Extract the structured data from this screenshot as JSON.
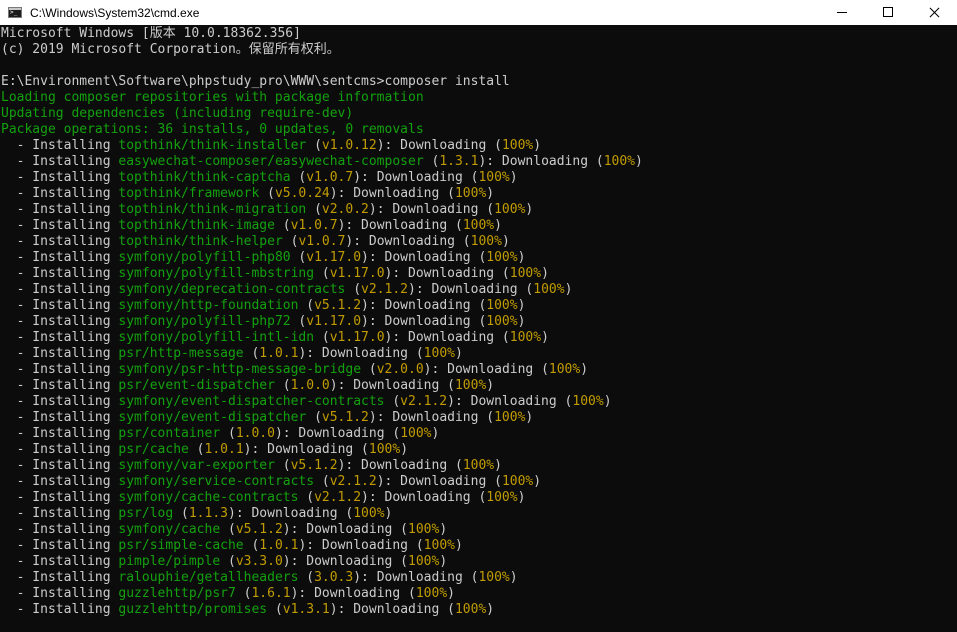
{
  "window": {
    "title": "C:\\Windows\\System32\\cmd.exe",
    "icon": "cmd-icon",
    "controls": {
      "minimize": "minimize-icon",
      "maximize": "maximize-icon",
      "close": "close-icon"
    }
  },
  "colors": {
    "background": "#0c0c0c",
    "text": "#cccccc",
    "info_green": "#13a10e",
    "highlight_yellow": "#c19c00"
  },
  "console": {
    "header": [
      "Microsoft Windows [版本 10.0.18362.356]",
      "(c) 2019 Microsoft Corporation。保留所有权利。"
    ],
    "prompt": "E:\\Environment\\Software\\phpstudy_pro\\WWW\\sentcms>",
    "command": "composer install",
    "info_lines": [
      "Loading composer repositories with package information",
      "Updating dependencies (including require-dev)",
      "Package operations: 36 installs, 0 updates, 0 removals"
    ],
    "install_prefix": "  - Installing ",
    "status_text": "Downloading",
    "progress": "100%",
    "packages": [
      {
        "name": "topthink/think-installer",
        "version": "v1.0.12"
      },
      {
        "name": "easywechat-composer/easywechat-composer",
        "version": "1.3.1"
      },
      {
        "name": "topthink/think-captcha",
        "version": "v1.0.7"
      },
      {
        "name": "topthink/framework",
        "version": "v5.0.24"
      },
      {
        "name": "topthink/think-migration",
        "version": "v2.0.2"
      },
      {
        "name": "topthink/think-image",
        "version": "v1.0.7"
      },
      {
        "name": "topthink/think-helper",
        "version": "v1.0.7"
      },
      {
        "name": "symfony/polyfill-php80",
        "version": "v1.17.0"
      },
      {
        "name": "symfony/polyfill-mbstring",
        "version": "v1.17.0"
      },
      {
        "name": "symfony/deprecation-contracts",
        "version": "v2.1.2"
      },
      {
        "name": "symfony/http-foundation",
        "version": "v5.1.2"
      },
      {
        "name": "symfony/polyfill-php72",
        "version": "v1.17.0"
      },
      {
        "name": "symfony/polyfill-intl-idn",
        "version": "v1.17.0"
      },
      {
        "name": "psr/http-message",
        "version": "1.0.1"
      },
      {
        "name": "symfony/psr-http-message-bridge",
        "version": "v2.0.0"
      },
      {
        "name": "psr/event-dispatcher",
        "version": "1.0.0"
      },
      {
        "name": "symfony/event-dispatcher-contracts",
        "version": "v2.1.2"
      },
      {
        "name": "symfony/event-dispatcher",
        "version": "v5.1.2"
      },
      {
        "name": "psr/container",
        "version": "1.0.0"
      },
      {
        "name": "psr/cache",
        "version": "1.0.1"
      },
      {
        "name": "symfony/var-exporter",
        "version": "v5.1.2"
      },
      {
        "name": "symfony/service-contracts",
        "version": "v2.1.2"
      },
      {
        "name": "symfony/cache-contracts",
        "version": "v2.1.2"
      },
      {
        "name": "psr/log",
        "version": "1.1.3"
      },
      {
        "name": "symfony/cache",
        "version": "v5.1.2"
      },
      {
        "name": "psr/simple-cache",
        "version": "1.0.1"
      },
      {
        "name": "pimple/pimple",
        "version": "v3.3.0"
      },
      {
        "name": "ralouphie/getallheaders",
        "version": "3.0.3"
      },
      {
        "name": "guzzlehttp/psr7",
        "version": "1.6.1"
      },
      {
        "name": "guzzlehttp/promises",
        "version": "v1.3.1"
      }
    ]
  }
}
